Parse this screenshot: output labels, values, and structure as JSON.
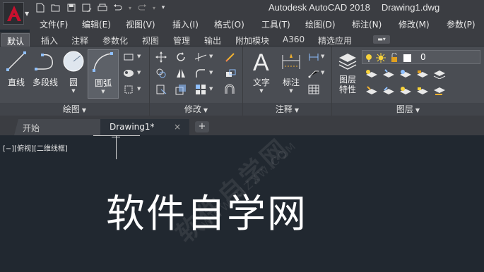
{
  "app": {
    "title": "Autodesk AutoCAD 2018",
    "document": "Drawing1.dwg",
    "logo_letter": "A",
    "brand_color": "#c8102e"
  },
  "quick_access": [
    {
      "icon": "new-icon",
      "glyph": "▢"
    },
    {
      "icon": "open-icon",
      "glyph": "▭"
    },
    {
      "icon": "save-icon",
      "glyph": "▪"
    },
    {
      "icon": "save-as-icon",
      "glyph": "▨"
    },
    {
      "icon": "print-icon",
      "glyph": "⎙"
    },
    {
      "icon": "undo-icon",
      "glyph": "↶"
    },
    {
      "icon": "redo-icon",
      "glyph": "↷"
    },
    {
      "icon": "customize-icon",
      "glyph": "▾"
    }
  ],
  "menu": [
    "文件(F)",
    "编辑(E)",
    "视图(V)",
    "插入(I)",
    "格式(O)",
    "工具(T)",
    "绘图(D)",
    "标注(N)",
    "修改(M)",
    "参数(P)"
  ],
  "ribbon_tabs": [
    "默认",
    "插入",
    "注释",
    "参数化",
    "视图",
    "管理",
    "输出",
    "附加模块",
    "A360",
    "精选应用"
  ],
  "ribbon_active_tab": "默认",
  "panels": {
    "draw": {
      "title": "绘图",
      "tools": [
        "直线",
        "多段线",
        "圆",
        "圆弧"
      ]
    },
    "modify": {
      "title": "修改"
    },
    "annotation": {
      "title": "注释",
      "tools": [
        "文字",
        "标注"
      ]
    },
    "layers": {
      "title": "图层",
      "properties_line1": "图层",
      "properties_line2": "特性",
      "current_layer": "0"
    }
  },
  "file_tabs": {
    "start": "开始",
    "drawing": "Drawing1*",
    "close": "×",
    "add": "+"
  },
  "canvas": {
    "viewport_control": "[−][俯视][二维线框]",
    "overlay_text": "软件自学网",
    "watermark_text": "软件自学网",
    "watermark_sub": "WWW.RJZXW.COM",
    "background_color": "#212830"
  }
}
